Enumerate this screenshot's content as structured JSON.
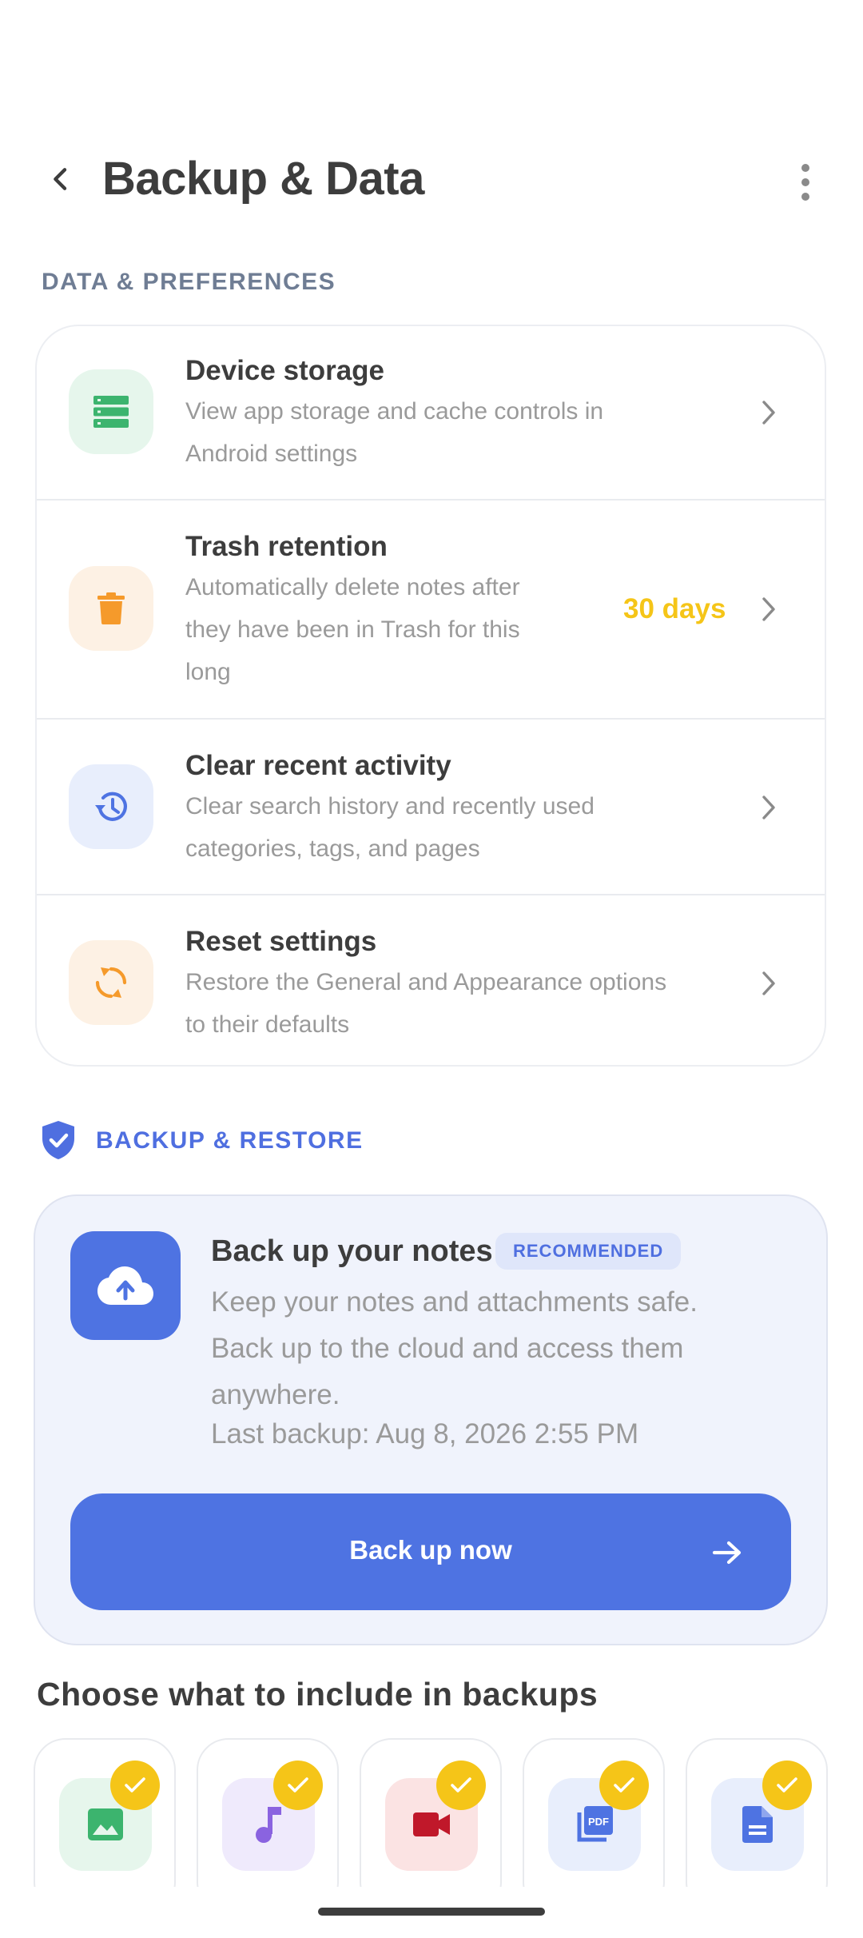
{
  "header": {
    "title": "Backup & Data"
  },
  "data_section": {
    "label": "DATA & PREFERENCES",
    "items": [
      {
        "title": "Device storage",
        "desc_lines": [
          "View app storage and cache controls in",
          "Android settings"
        ],
        "icon": "storage-icon",
        "icon_color": "#3cb46e",
        "icon_bg": "#e6f6ec"
      },
      {
        "title": "Trash retention",
        "desc_lines": [
          "Automatically delete notes after",
          "they have been in Trash for this",
          "long"
        ],
        "value": "30 days",
        "icon": "trash-icon",
        "icon_color": "#f59a2b",
        "icon_bg": "#fdf1e4"
      },
      {
        "title": "Clear recent activity",
        "desc_lines": [
          "Clear search history and recently used",
          "categories, tags, and pages"
        ],
        "icon": "history-icon",
        "icon_color": "#4e73e2",
        "icon_bg": "#e8eefc"
      },
      {
        "title": "Reset settings",
        "desc_lines": [
          "Restore the General and Appearance options",
          "to their defaults"
        ],
        "icon": "reset-icon",
        "icon_color": "#f59a2b",
        "icon_bg": "#fdf1e4"
      }
    ]
  },
  "backup_section": {
    "label": "BACKUP & RESTORE",
    "card": {
      "title": "Back up your notes",
      "badge": "RECOMMENDED",
      "desc_lines": [
        "Keep your notes and attachments safe.",
        "Back up to the cloud and access them",
        "anywhere."
      ],
      "last_backup": "Last backup: Aug 8, 2026 2:55 PM",
      "button_label": "Back up now"
    }
  },
  "include": {
    "title": "Choose what to include in backups",
    "items": [
      {
        "icon": "image-icon",
        "checked": true,
        "color": "#3cb46e",
        "bg": "#e6f6ec"
      },
      {
        "icon": "music-icon",
        "checked": true,
        "color": "#8a63e0",
        "bg": "#efeafc"
      },
      {
        "icon": "video-icon",
        "checked": true,
        "color": "#c0182a",
        "bg": "#fbe3e3"
      },
      {
        "icon": "pdf-icon",
        "checked": true,
        "color": "#4e73e2",
        "bg": "#e8eefc"
      },
      {
        "icon": "document-icon",
        "checked": true,
        "color": "#4e73e2",
        "bg": "#e8eefc"
      }
    ]
  },
  "colors": {
    "accent": "#4e73e2",
    "value_yellow": "#f5c518",
    "section_grey": "#6f7d94"
  }
}
